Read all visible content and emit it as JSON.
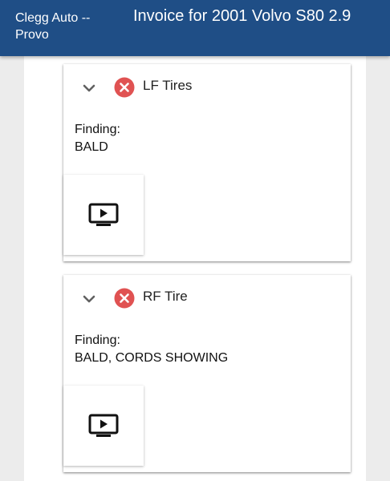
{
  "header": {
    "shop_name": "Clegg Auto -- Provo",
    "title": "Invoice for 2001 Volvo S80 2.9"
  },
  "colors": {
    "app_bar": "#1f4e86",
    "status_fail": "#e05252"
  },
  "items": [
    {
      "title": "LF Tires",
      "status_icon": "close-circle-icon",
      "finding_label": "Finding:",
      "finding_value": "BALD",
      "media_icon": "video-play-icon"
    },
    {
      "title": "RF Tire",
      "status_icon": "close-circle-icon",
      "finding_label": "Finding:",
      "finding_value": "BALD, CORDS SHOWING",
      "media_icon": "video-play-icon"
    }
  ]
}
